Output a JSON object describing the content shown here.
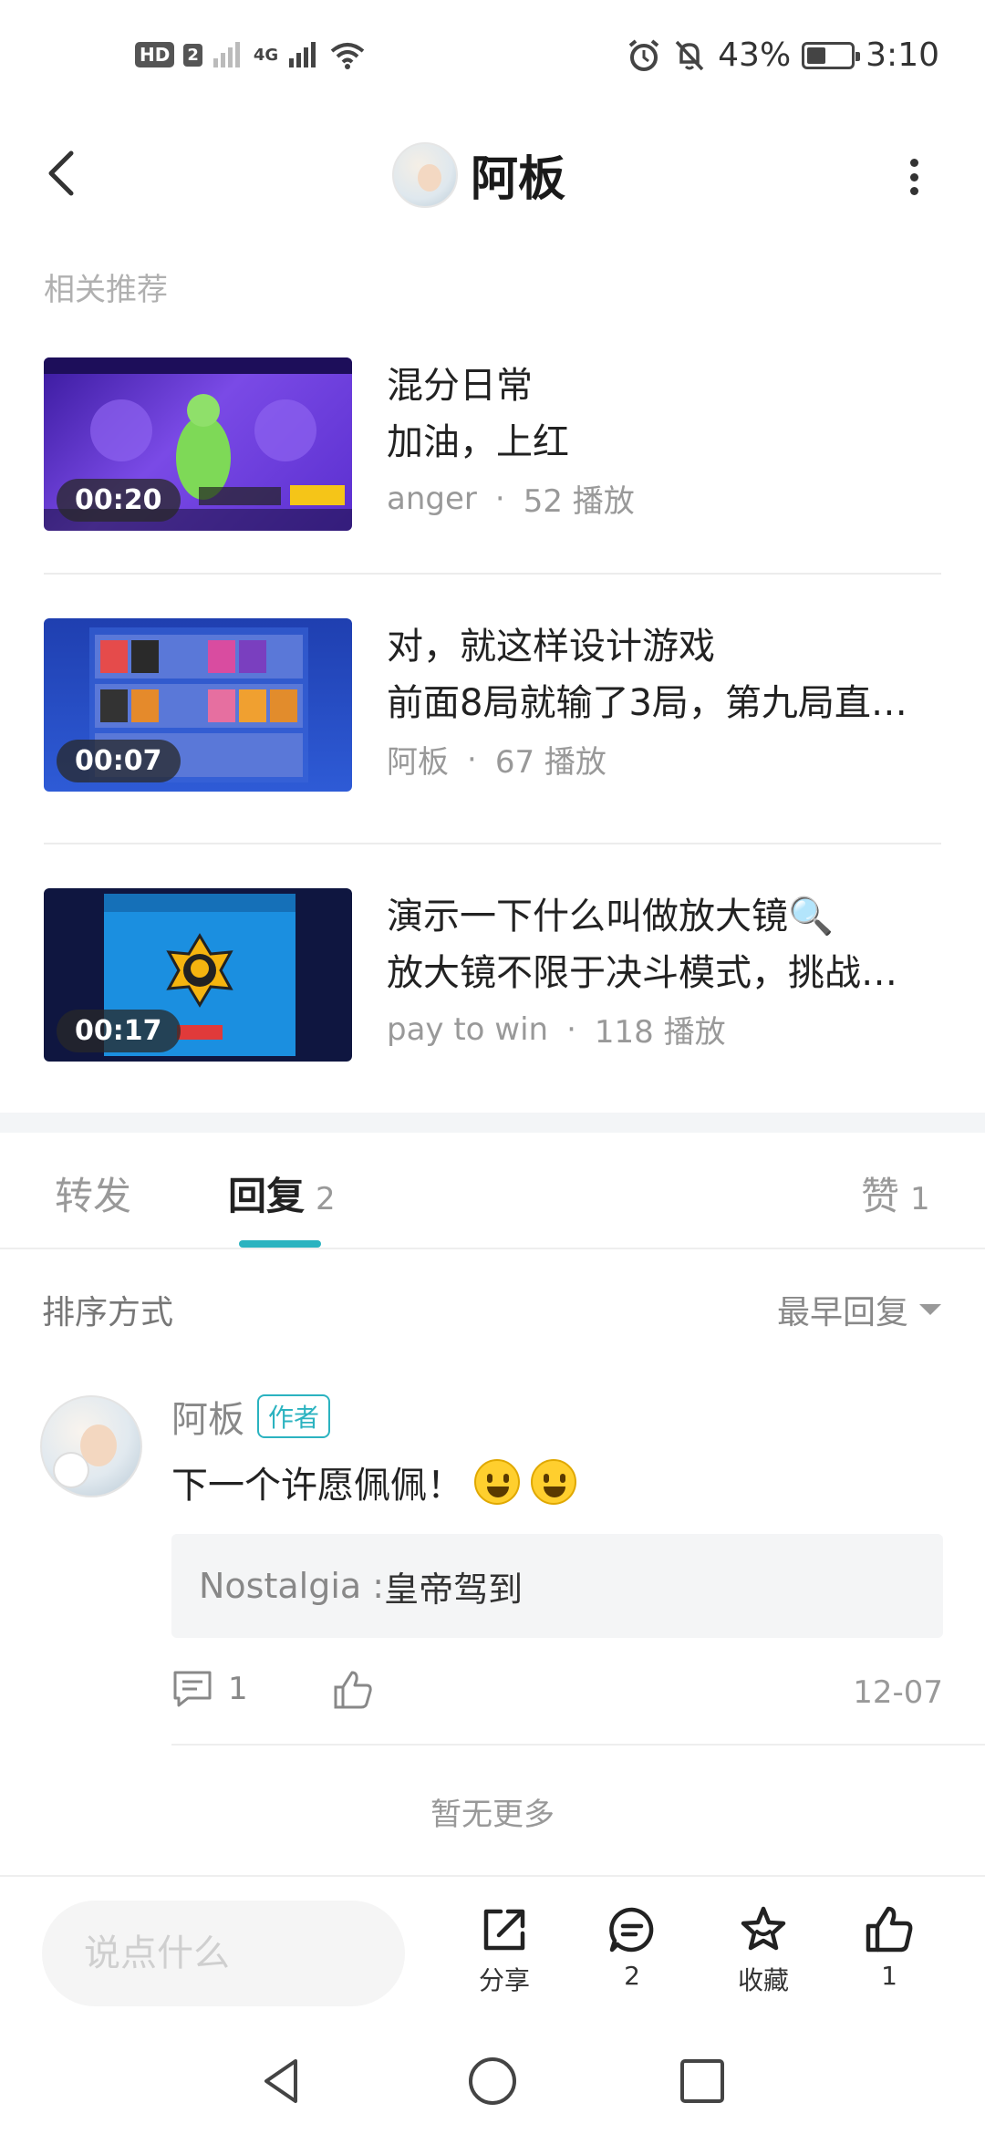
{
  "status_bar": {
    "left_badges": [
      "HD",
      "2"
    ],
    "network": "4G",
    "battery_percent": "43%",
    "battery_level": 0.43,
    "time": "3:10",
    "icons": [
      "alarm-icon",
      "mute-icon",
      "wifi-icon",
      "signal-icon"
    ]
  },
  "header": {
    "title": "阿板",
    "icons": [
      "back-icon",
      "more-icon"
    ]
  },
  "related": {
    "label": "相关推荐",
    "items": [
      {
        "duration": "00:20",
        "title": "混分日常",
        "subtitle": "加油，上红",
        "author": "anger",
        "separator": "·",
        "plays": "52 播放",
        "thumb_color": "#6a3fd6"
      },
      {
        "duration": "00:07",
        "title": "对，就这样设计游戏",
        "subtitle": "前面8局就输了3局，第九局直…",
        "author": "阿板",
        "separator": "·",
        "plays": "67 播放",
        "thumb_color": "#2a55c8"
      },
      {
        "duration": "00:17",
        "title": "演示一下什么叫做放大镜🔍",
        "subtitle": "放大镜不限于决斗模式，挑战…",
        "author": "pay  to  win",
        "separator": "·",
        "plays": "118 播放",
        "thumb_color": "#1b8fe0"
      }
    ]
  },
  "tabs": {
    "forward": {
      "label": "转发"
    },
    "reply": {
      "label": "回复",
      "count": "2"
    },
    "like": {
      "label": "赞",
      "count": "1"
    }
  },
  "sort": {
    "label": "排序方式",
    "selected": "最早回复"
  },
  "comment": {
    "author": "阿板",
    "badge": "作者",
    "text": "下一个许愿佩佩！",
    "emoji_count": 2,
    "quote_user": "Nostalgia : ",
    "quote_text": "皇帝驾到",
    "reply_count": "1",
    "date": "12-07"
  },
  "no_more": "暂无更多",
  "action_bar": {
    "input_placeholder": "说点什么",
    "share_label": "分享",
    "comment_count": "2",
    "favorite_label": "收藏",
    "like_count": "1"
  },
  "colors": {
    "accent": "#2bb3c0",
    "text_primary": "#222222",
    "text_secondary": "#999999"
  }
}
